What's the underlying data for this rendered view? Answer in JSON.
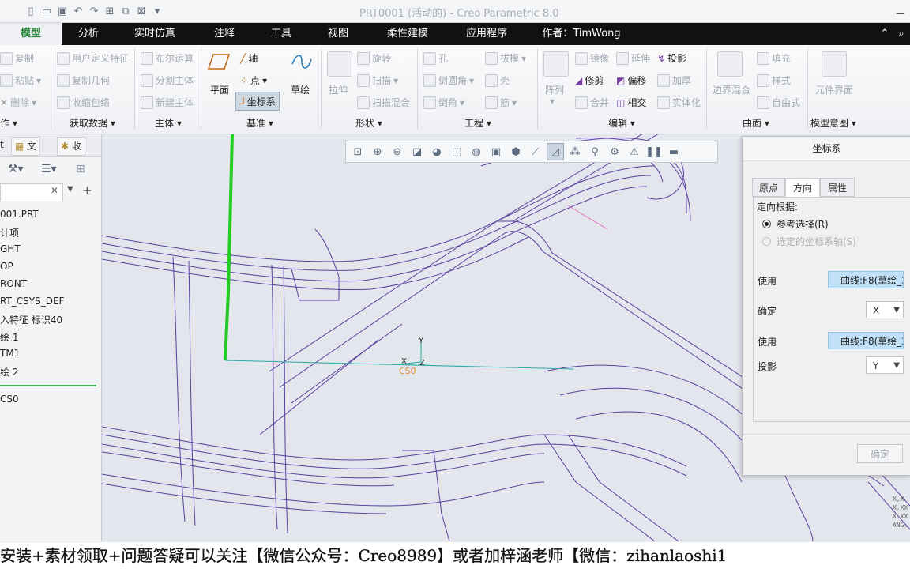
{
  "window": {
    "title": "PRT0001 (活动的) - Creo Parametric 8.0"
  },
  "tabs": [
    {
      "label": "模型"
    },
    {
      "label": "分析"
    },
    {
      "label": "实时仿真"
    },
    {
      "label": "注释"
    },
    {
      "label": "工具"
    },
    {
      "label": "视图"
    },
    {
      "label": "柔性建模"
    },
    {
      "label": "应用程序"
    },
    {
      "label": "作者：TimWong"
    }
  ],
  "ribbon": {
    "col1": [
      "复制",
      "粘贴",
      "删除",
      "作"
    ],
    "get_data": {
      "items": [
        "用户定义特征",
        "复制几何",
        "收缩包络"
      ],
      "group": "获取数据"
    },
    "body": {
      "items": [
        "布尔运算",
        "分割主体",
        "新建主体"
      ],
      "group": "主体"
    },
    "datum": {
      "plane": "平面",
      "axis": "轴",
      "point": "点",
      "csys": "坐标系",
      "sketch": "草绘",
      "group": "基准"
    },
    "shapes": {
      "extrude": "拉伸",
      "items": [
        "旋转",
        "扫描",
        "扫描混合"
      ],
      "group": "形状"
    },
    "engineering": {
      "items": [
        "孔",
        "倒圆角",
        "倒角",
        "拔模",
        "壳",
        "筋"
      ],
      "group": "工程"
    },
    "editing": {
      "pattern": "阵列",
      "items": [
        "镜像",
        "修剪",
        "合并",
        "延伸",
        "偏移",
        "相交",
        "投影",
        "加厚",
        "实体化"
      ],
      "group": "编辑"
    },
    "surfaces": {
      "boundary": "边界混合",
      "items": [
        "填充",
        "样式",
        "自由式"
      ],
      "group": "曲面"
    },
    "model_intent": {
      "label": "元件界面",
      "group": "模型意图"
    }
  },
  "left_panel": {
    "tabs": [
      "文",
      "收"
    ],
    "tree": [
      "001.PRT",
      "计项",
      "GHT",
      "OP",
      "RONT",
      "RT_CSYS_DEF",
      "入特征 标识40",
      "绘 1",
      "TM1",
      "绘 2",
      "CS0"
    ]
  },
  "graphics": {
    "csys_label": "CS0",
    "axis_x": "X",
    "axis_y": "Y",
    "axis_z": "Z",
    "coord_readout": [
      "X,X",
      "X.XX",
      "X.XX",
      "ANG."
    ]
  },
  "dialog": {
    "title": "坐标系",
    "tabs": [
      "原点",
      "方向",
      "属性"
    ],
    "orient_by": "定向根据:",
    "radio1": "参考选择(R)",
    "radio2": "选定的坐标系轴(S)",
    "use1_label": "使用",
    "use1_value": "曲线:F8(草绘_2",
    "determine_label": "确定",
    "determine_value": "X",
    "use2_label": "使用",
    "use2_value": "曲线:F8(草绘_2",
    "project_label": "投影",
    "project_value": "Y",
    "ok_button": "确定"
  },
  "subtitle": "安装+素材领取+问题答疑可以关注【微信公众号：Creo8989】或者加梓涵老师【微信：zihanlaoshi1"
}
